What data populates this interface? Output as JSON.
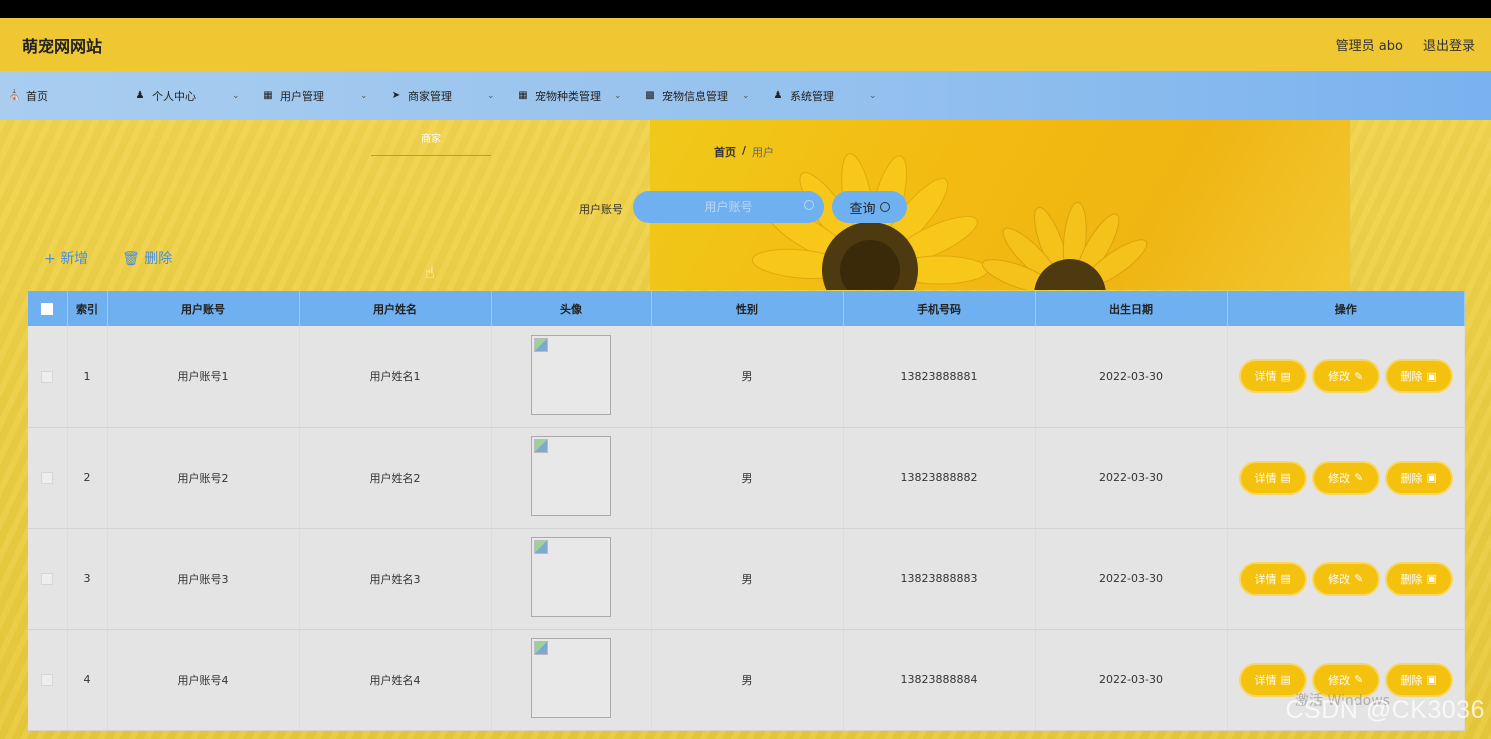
{
  "header": {
    "site_title": "萌宠网网站",
    "user_label": "管理员 abo",
    "logout_label": "退出登录"
  },
  "nav": {
    "items": [
      {
        "label": "首页",
        "icon": "home-icon"
      },
      {
        "label": "个人中心",
        "icon": "user-icon"
      },
      {
        "label": "用户管理",
        "icon": "grid-icon"
      },
      {
        "label": "商家管理",
        "icon": "send-icon"
      },
      {
        "label": "宠物种类管理",
        "icon": "grid-icon"
      },
      {
        "label": "宠物信息管理",
        "icon": "monitor-icon"
      },
      {
        "label": "系统管理",
        "icon": "user-icon"
      }
    ]
  },
  "dropdown": {
    "item": "商家"
  },
  "breadcrumb": {
    "home": "首页",
    "sep": "/",
    "current": "用户"
  },
  "search": {
    "label": "用户账号",
    "placeholder": "用户账号",
    "button": "查询"
  },
  "actions": {
    "add": "新增",
    "delete": "删除"
  },
  "table": {
    "headers": [
      "索引",
      "用户账号",
      "用户姓名",
      "头像",
      "性别",
      "手机号码",
      "出生日期",
      "操作"
    ],
    "rows": [
      {
        "index": "1",
        "account": "用户账号1",
        "name": "用户姓名1",
        "gender": "男",
        "phone": "13823888881",
        "birth": "2022-03-30"
      },
      {
        "index": "2",
        "account": "用户账号2",
        "name": "用户姓名2",
        "gender": "男",
        "phone": "13823888882",
        "birth": "2022-03-30"
      },
      {
        "index": "3",
        "account": "用户账号3",
        "name": "用户姓名3",
        "gender": "男",
        "phone": "13823888883",
        "birth": "2022-03-30"
      },
      {
        "index": "4",
        "account": "用户账号4",
        "name": "用户姓名4",
        "gender": "男",
        "phone": "13823888884",
        "birth": "2022-03-30"
      }
    ],
    "ops": {
      "detail": "详情",
      "edit": "修改",
      "remove": "删除"
    }
  },
  "overlay": {
    "watermark": "CSDN @CK3036",
    "activate": "激活 Windows"
  }
}
